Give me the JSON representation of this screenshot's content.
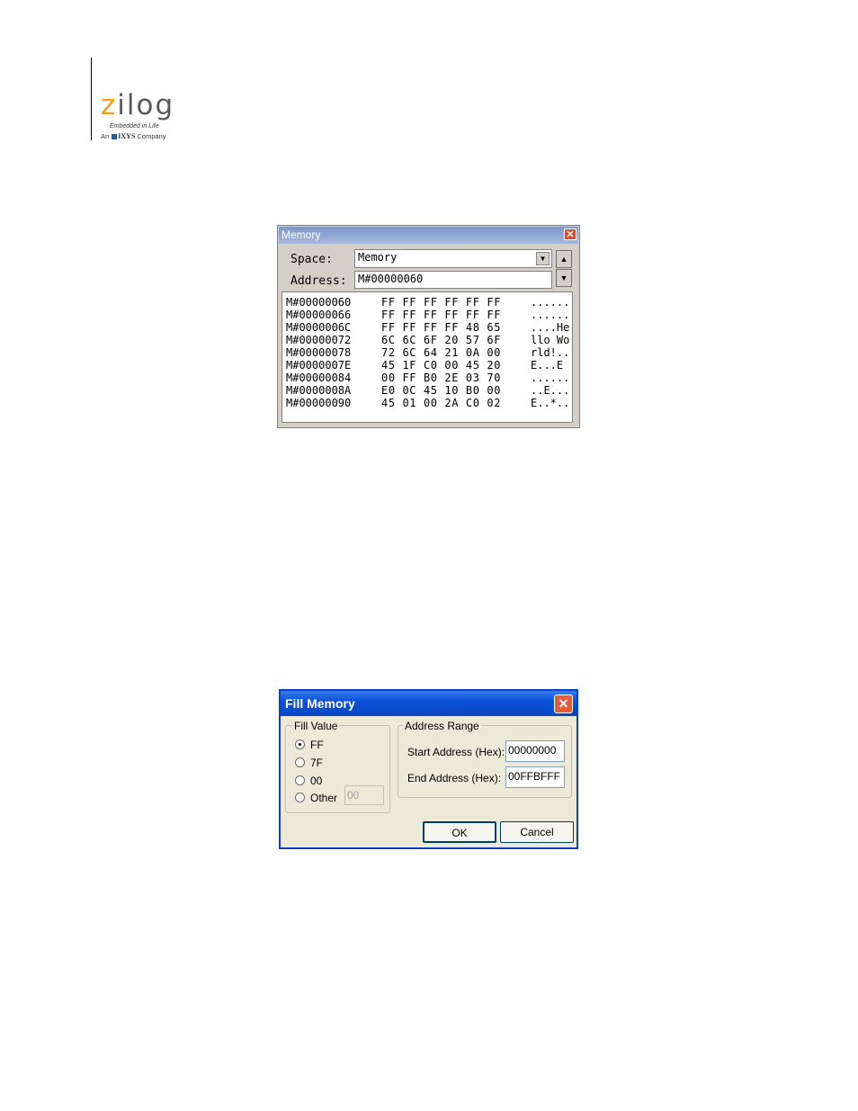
{
  "logo": {
    "brand": "ilog",
    "brand_z": "z",
    "tagline": "Embedded in Life",
    "company_prefix": "An",
    "company_name": "IXYS",
    "company_suffix": "Company",
    "colors": {
      "z": "#f0a020",
      "word": "#5a5a5a",
      "ixys_square": "#1a5aa8"
    }
  },
  "memory_window": {
    "title": "Memory",
    "close_icon": "close-icon",
    "space_label": "Space:",
    "space_value": "Memory",
    "address_label": "Address:",
    "address_value": "M#00000060",
    "rows": [
      {
        "addr": "M#00000060",
        "bytes": "FF FF FF FF FF FF",
        "ascii": "......"
      },
      {
        "addr": "M#00000066",
        "bytes": "FF FF FF FF FF FF",
        "ascii": "......"
      },
      {
        "addr": "M#0000006C",
        "bytes": "FF FF FF FF 48 65",
        "ascii": "....He"
      },
      {
        "addr": "M#00000072",
        "bytes": "6C 6C 6F 20 57 6F",
        "ascii": "llo Wo"
      },
      {
        "addr": "M#00000078",
        "bytes": "72 6C 64 21 0A 00",
        "ascii": "rld!.."
      },
      {
        "addr": "M#0000007E",
        "bytes": "45 1F C0 00 45 20",
        "ascii": "E...E "
      },
      {
        "addr": "M#00000084",
        "bytes": "00 FF B0 2E 03 70",
        "ascii": "......"
      },
      {
        "addr": "M#0000008A",
        "bytes": "E0 0C 45 10 B0 00",
        "ascii": "..E..."
      },
      {
        "addr": "M#00000090",
        "bytes": "45 01 00 2A C0 02",
        "ascii": "E..*.."
      }
    ]
  },
  "fill_dialog": {
    "title": "Fill Memory",
    "fill_value_group": "Fill Value",
    "options": [
      "FF",
      "7F",
      "00",
      "Other"
    ],
    "selected": "FF",
    "other_value": "00",
    "address_range_group": "Address Range",
    "start_label": "Start Address (Hex):",
    "start_value": "00000000",
    "end_label": "End Address (Hex):",
    "end_value": "00FFBFFF",
    "ok_label": "OK",
    "cancel_label": "Cancel"
  }
}
